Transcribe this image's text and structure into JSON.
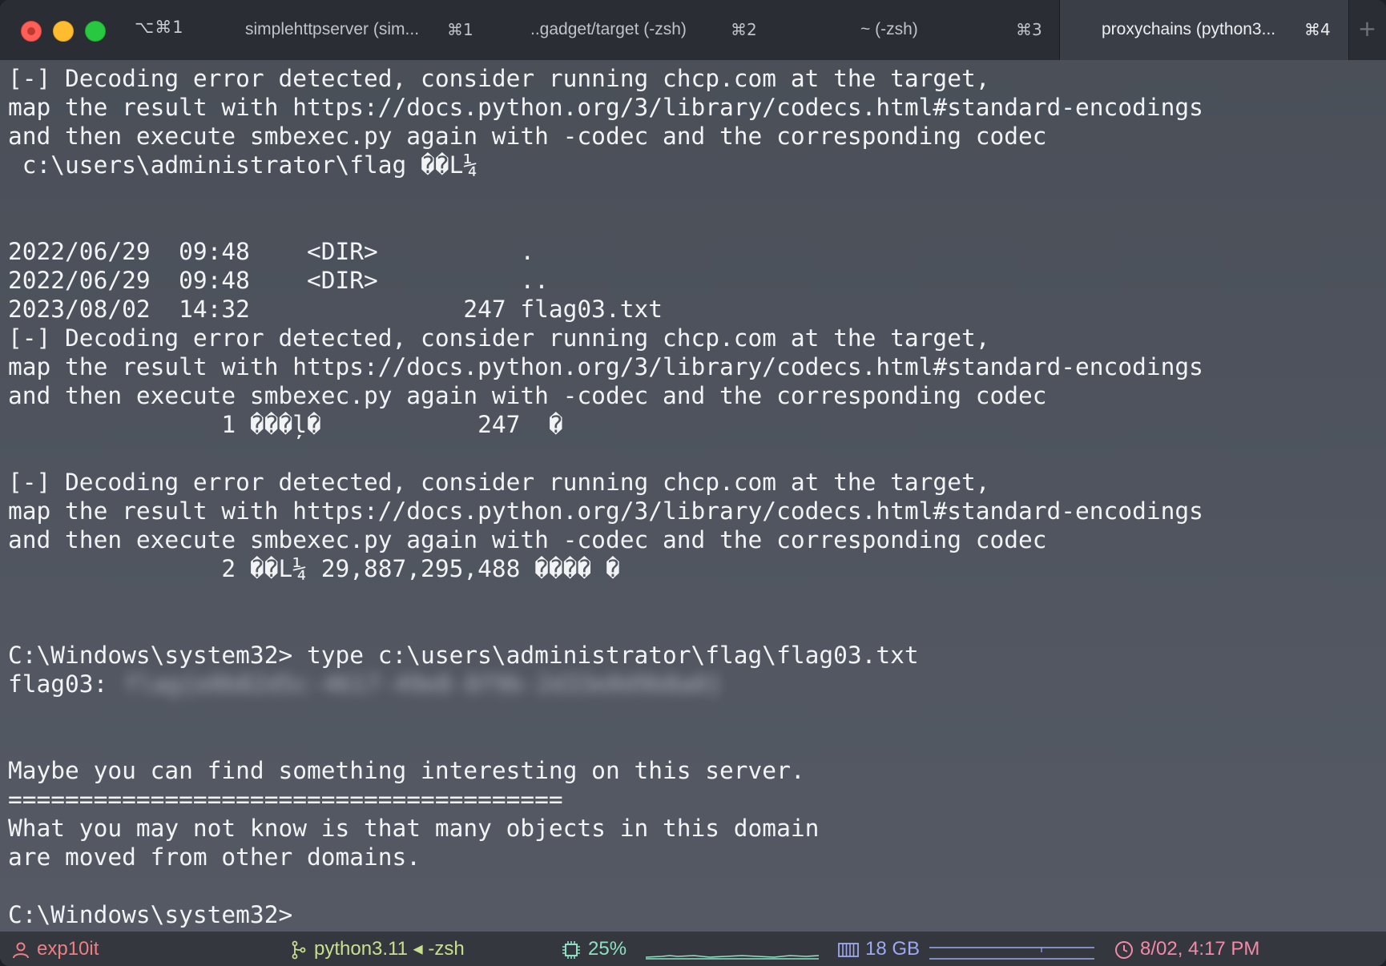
{
  "window": {
    "shortcut": "⌥⌘1"
  },
  "tabs": [
    {
      "title": "simplehttpserver (sim...",
      "key": "⌘1"
    },
    {
      "title": "..gadget/target (-zsh)",
      "key": "⌘2"
    },
    {
      "title": "~ (-zsh)",
      "key": "⌘3"
    },
    {
      "title": "proxychains (python3...",
      "key": "⌘4"
    }
  ],
  "new_tab_symbol": "+",
  "terminal": {
    "lines": [
      "[-] Decoding error detected, consider running chcp.com at the target,",
      "map the result with https://docs.python.org/3/library/codecs.html#standard-encodings",
      "and then execute smbexec.py again with -codec and the corresponding codec",
      " c:\\users\\administrator\\flag ��L¼",
      "",
      "",
      "2022/06/29  09:48    <DIR>          .",
      "2022/06/29  09:48    <DIR>          ..",
      "2023/08/02  14:32               247 flag03.txt",
      "[-] Decoding error detected, consider running chcp.com at the target,",
      "map the result with https://docs.python.org/3/library/codecs.html#standard-encodings",
      "and then execute smbexec.py again with -codec and the corresponding codec",
      "               1 ���ļ�           247  �",
      "",
      "[-] Decoding error detected, consider running chcp.com at the target,",
      "map the result with https://docs.python.org/3/library/codecs.html#standard-encodings",
      "and then execute smbexec.py again with -codec and the corresponding codec",
      "               2 ��L¼ 29,887,295,488 ���� �",
      "",
      "",
      "C:\\Windows\\system32> type c:\\users\\administrator\\flag\\flag03.txt",
      "flag03: ",
      "",
      "",
      "Maybe you can find something interesting on this server.",
      "=======================================",
      "What you may not know is that many objects in this domain",
      "are moved from other domains.",
      "",
      "C:\\Windows\\system32>"
    ],
    "flag_value_redacted": "flag{e0b82d5c-4617-49e8-8f9b-2d33e0d9b8a0}"
  },
  "statusbar": {
    "user": "exp10it",
    "job": "python3.11 ◂ -zsh",
    "cpu": "25%",
    "memory": "18 GB",
    "datetime": "8/02, 4:17 PM"
  },
  "colors": {
    "background": "#4d525c",
    "titlebar": "#2a2d33",
    "text": "#f2f3f5",
    "user": "#f07e82",
    "job": "#c8e08e",
    "cpu": "#8fe0c0",
    "memory": "#9ea9f0",
    "time": "#f28aa8"
  }
}
